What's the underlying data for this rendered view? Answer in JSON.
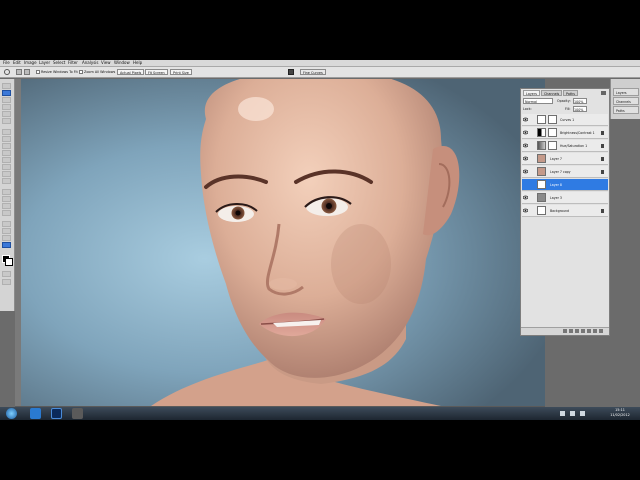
{
  "app": {
    "menus": [
      "File",
      "Edit",
      "Image",
      "Layer",
      "Select",
      "Filter",
      "Analysis",
      "View",
      "Window",
      "Help"
    ]
  },
  "options_bar": {
    "resize_windows_label": "Resize Windows To Fit",
    "zoom_all_windows_label": "Zoom All Windows",
    "actual_pixels_label": "Actual Pixels",
    "fit_screen_label": "Fit Screen",
    "print_size_label": "Print Size",
    "workspace_label": "Fine Curves"
  },
  "dock": {
    "tabs": [
      "Layers",
      "Channels",
      "Paths"
    ]
  },
  "layers_panel": {
    "tabs": [
      "Layers",
      "Channels",
      "Paths"
    ],
    "blend_mode": "Normal",
    "opacity_label": "Opacity:",
    "opacity_value": "100%",
    "lock_label": "Lock:",
    "fill_label": "Fill:",
    "fill_value": "100%",
    "layers": [
      {
        "name": "Curves 1",
        "selected": false,
        "thumb": "#ffffff"
      },
      {
        "name": "Brightness/Contrast 1",
        "selected": false,
        "thumb": "#ffffff"
      },
      {
        "name": "Hue/Saturation 1",
        "selected": false,
        "thumb": "#ffffff"
      },
      {
        "name": "Layer 7",
        "selected": false,
        "thumb": "#c49a8a"
      },
      {
        "name": "Layer 7 copy",
        "selected": false,
        "thumb": "#c49a8a"
      },
      {
        "name": "Layer 8",
        "selected": true,
        "thumb": "#ffffff"
      },
      {
        "name": "Layer 3",
        "selected": false,
        "thumb": "#8a8a8a"
      },
      {
        "name": "Background",
        "selected": false,
        "thumb": "#ffffff"
      }
    ]
  },
  "taskbar": {
    "time": "15:11",
    "date": "11/02/2012"
  },
  "colors": {
    "selection": "#2f7be3",
    "canvas_bg": "#8fb3c9",
    "skin": "#e2b49c"
  }
}
